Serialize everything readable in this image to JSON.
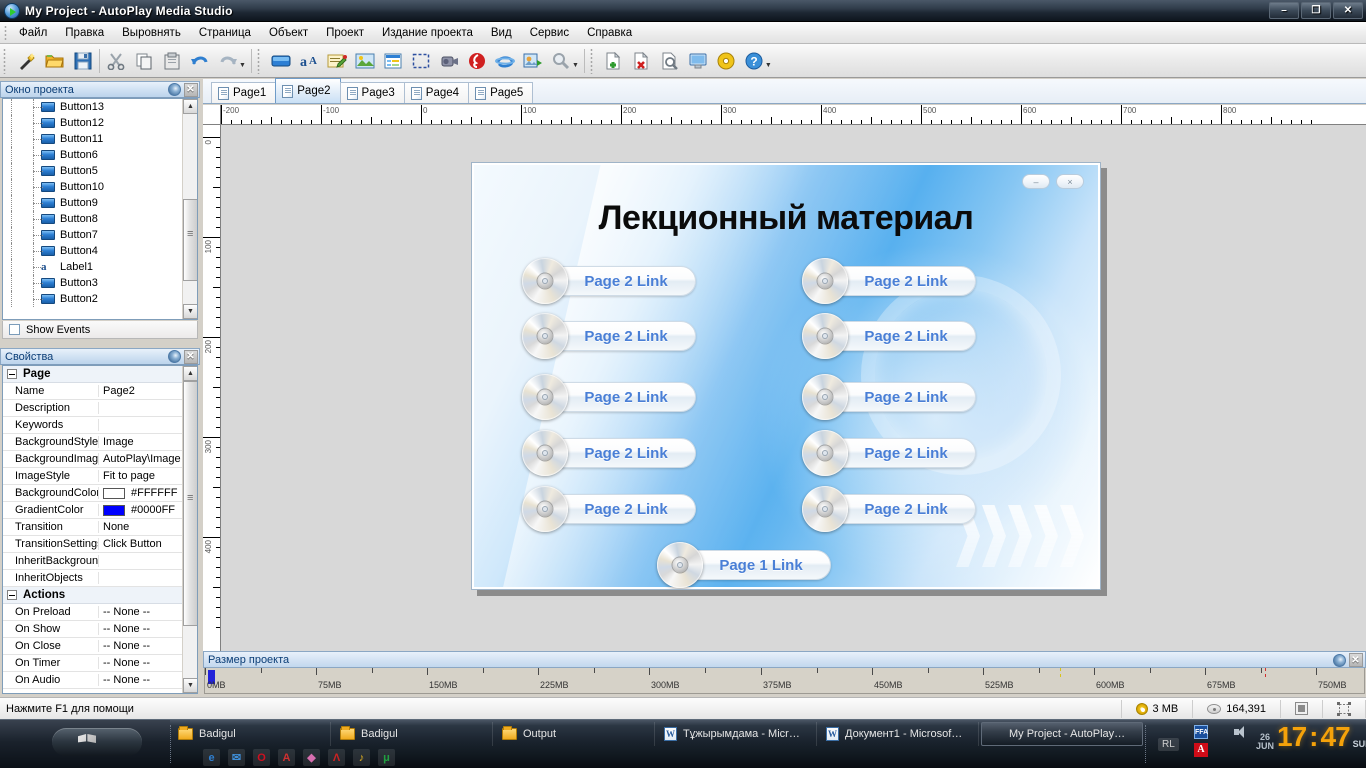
{
  "window": {
    "title": "My Project - AutoPlay Media Studio",
    "logo_icon": "autoplay-logo-icon",
    "minimize_label": "–",
    "restore_label": "❐",
    "close_label": "✕"
  },
  "menu": {
    "items": [
      {
        "label": "Файл"
      },
      {
        "label": "Правка"
      },
      {
        "label": "Выровнять"
      },
      {
        "label": "Страница"
      },
      {
        "label": "Объект"
      },
      {
        "label": "Проект"
      },
      {
        "label": "Издание проекта"
      },
      {
        "label": "Вид"
      },
      {
        "label": "Сервис"
      },
      {
        "label": "Справка"
      }
    ]
  },
  "toolbar": {
    "group1": [
      {
        "icon": "new-project-wizard-icon"
      },
      {
        "icon": "open-folder-icon"
      },
      {
        "icon": "save-icon"
      }
    ],
    "group2": [
      {
        "icon": "cut-scissors-icon"
      },
      {
        "icon": "copy-icon"
      },
      {
        "icon": "paste-icon"
      },
      {
        "icon": "undo-icon"
      },
      {
        "icon": "redo-icon"
      }
    ],
    "group3": [
      {
        "icon": "button-object-icon"
      },
      {
        "icon": "text-object-icon"
      },
      {
        "icon": "paragraph-object-icon"
      },
      {
        "icon": "image-object-icon"
      },
      {
        "icon": "listbox-object-icon"
      },
      {
        "icon": "region-object-icon"
      },
      {
        "icon": "video-object-icon"
      },
      {
        "icon": "flash-object-icon"
      },
      {
        "icon": "web-object-icon"
      },
      {
        "icon": "slideshow-object-icon"
      },
      {
        "icon": "zoom-icon"
      }
    ],
    "group4": [
      {
        "icon": "add-page-icon"
      },
      {
        "icon": "delete-page-icon"
      },
      {
        "icon": "preview-page-icon"
      },
      {
        "icon": "preview-project-icon"
      },
      {
        "icon": "build-cd-icon"
      },
      {
        "icon": "help-icon"
      }
    ]
  },
  "project_panel": {
    "title": "Окно проекта",
    "moon_icon": "auto-hide-icon",
    "close_icon": "close-icon",
    "tree": [
      {
        "label": "Button13",
        "icon": "button-icon"
      },
      {
        "label": "Button12",
        "icon": "button-icon"
      },
      {
        "label": "Button11",
        "icon": "button-icon"
      },
      {
        "label": "Button6",
        "icon": "button-icon"
      },
      {
        "label": "Button5",
        "icon": "button-icon"
      },
      {
        "label": "Button10",
        "icon": "button-icon"
      },
      {
        "label": "Button9",
        "icon": "button-icon"
      },
      {
        "label": "Button8",
        "icon": "button-icon"
      },
      {
        "label": "Button7",
        "icon": "button-icon"
      },
      {
        "label": "Button4",
        "icon": "button-icon"
      },
      {
        "label": "Label1",
        "icon": "label-icon"
      },
      {
        "label": "Button3",
        "icon": "button-icon"
      },
      {
        "label": "Button2",
        "icon": "button-icon"
      }
    ],
    "show_events_label": "Show Events",
    "show_events_checked": false
  },
  "properties_panel": {
    "title": "Свойства",
    "moon_icon": "auto-hide-icon",
    "close_icon": "close-icon",
    "groups": [
      {
        "name": "Page",
        "rows": [
          {
            "key": "Name",
            "value": "Page2"
          },
          {
            "key": "Description",
            "value": ""
          },
          {
            "key": "Keywords",
            "value": ""
          },
          {
            "key": "BackgroundStyle",
            "value": "Image"
          },
          {
            "key": "BackgroundImage",
            "value": "AutoPlay\\Image"
          },
          {
            "key": "ImageStyle",
            "value": "Fit to page"
          },
          {
            "key": "BackgroundColor",
            "value": "#FFFFFF",
            "swatch": "#FFFFFF"
          },
          {
            "key": "GradientColor",
            "value": "#0000FF",
            "swatch": "#0000FF"
          },
          {
            "key": "Transition",
            "value": "None"
          },
          {
            "key": "TransitionSettings",
            "value": "Click Button"
          },
          {
            "key": "InheritBackground",
            "value": ""
          },
          {
            "key": "InheritObjects",
            "value": ""
          }
        ]
      },
      {
        "name": "Actions",
        "rows": [
          {
            "key": "On Preload",
            "value": "-- None --"
          },
          {
            "key": "On Show",
            "value": "-- None --"
          },
          {
            "key": "On Close",
            "value": "-- None --"
          },
          {
            "key": "On Timer",
            "value": "-- None --"
          },
          {
            "key": "On Audio",
            "value": "-- None --"
          }
        ]
      }
    ]
  },
  "tabs": {
    "items": [
      {
        "label": "Page1",
        "active": false
      },
      {
        "label": "Page2",
        "active": true
      },
      {
        "label": "Page3",
        "active": false
      },
      {
        "label": "Page4",
        "active": false
      },
      {
        "label": "Page5",
        "active": false
      }
    ]
  },
  "rulers": {
    "horizontal_labels": [
      "-200",
      "-100",
      "0",
      "100",
      "200",
      "300",
      "400",
      "500",
      "600",
      "700",
      "800"
    ],
    "vertical_labels": [
      "0",
      "100",
      "200",
      "300",
      "400"
    ]
  },
  "page_canvas": {
    "title": "Лекционный материал",
    "minimize_label": "–",
    "close_label": "×",
    "buttons": [
      {
        "label": "Page 2 Link",
        "col": 0,
        "row": 0
      },
      {
        "label": "Page 2 Link",
        "col": 0,
        "row": 1
      },
      {
        "label": "Page 2 Link",
        "col": 0,
        "row": 2
      },
      {
        "label": "Page 2 Link",
        "col": 0,
        "row": 3
      },
      {
        "label": "Page 2 Link",
        "col": 0,
        "row": 4
      },
      {
        "label": "Page 2 Link",
        "col": 1,
        "row": 0
      },
      {
        "label": "Page 2 Link",
        "col": 1,
        "row": 1
      },
      {
        "label": "Page 2 Link",
        "col": 1,
        "row": 2
      },
      {
        "label": "Page 2 Link",
        "col": 1,
        "row": 3
      },
      {
        "label": "Page 2 Link",
        "col": 1,
        "row": 4
      },
      {
        "label": "Page 1 Link",
        "col": 2,
        "row": 5
      }
    ]
  },
  "size_panel": {
    "title": "Размер проекта",
    "labels": [
      "0MB",
      "75MB",
      "150MB",
      "225MB",
      "300MB",
      "375MB",
      "450MB",
      "525MB",
      "600MB",
      "675MB",
      "750MB"
    ]
  },
  "statusbar": {
    "message": "Нажмите F1 для помощи",
    "project_size": "3 MB",
    "free_space": "164,391",
    "cd_icon": "cd-icon",
    "disk-icon": "disk-icon",
    "resize_icon": "resize-icon",
    "selection_icon": "selection-icon"
  },
  "taskbar": {
    "start_icon": "windows-start-icon",
    "items": [
      {
        "label": "Badigul",
        "icon": "folder-icon",
        "active": false
      },
      {
        "label": "Badigul",
        "icon": "folder-icon",
        "active": false
      },
      {
        "label": "Output",
        "icon": "folder-icon",
        "active": false
      },
      {
        "label": "Тұжырымдама - Micr…",
        "icon": "word-icon",
        "active": false
      },
      {
        "label": "Документ1 - Microsof…",
        "icon": "word-icon",
        "active": false
      },
      {
        "label": "My Project - AutoPlay…",
        "icon": "autoplay-logo-icon",
        "active": true
      }
    ],
    "quicklaunch": [
      {
        "icon": "internet-explorer-icon",
        "glyph": "e",
        "color": "#2f7fd0"
      },
      {
        "icon": "outlook-express-icon",
        "glyph": "✉",
        "color": "#3f8fd8"
      },
      {
        "icon": "opera-icon",
        "glyph": "O",
        "color": "#cf1020"
      },
      {
        "icon": "abbyy-icon",
        "glyph": "A",
        "color": "#d03030"
      },
      {
        "icon": "picasa-icon",
        "glyph": "◆",
        "color": "#d86fb0"
      },
      {
        "icon": "adobe-reader-icon",
        "glyph": "Λ",
        "color": "#cc2222"
      },
      {
        "icon": "winamp-icon",
        "glyph": "♪",
        "color": "#e0b020"
      },
      {
        "icon": "mathcad-icon",
        "glyph": "μ",
        "color": "#20a040"
      }
    ],
    "tray": {
      "layout_indicator": "RL",
      "ffa_icon": "ffa-icon",
      "ffa_label": "FFA",
      "volume_icon": "volume-icon",
      "avira_icon": "avira-icon",
      "avira_label": "Α"
    },
    "clock": {
      "day": "26",
      "month": "JUN",
      "hours": "17",
      "separator": ":",
      "minutes": "47",
      "weekday": "SUN"
    }
  }
}
